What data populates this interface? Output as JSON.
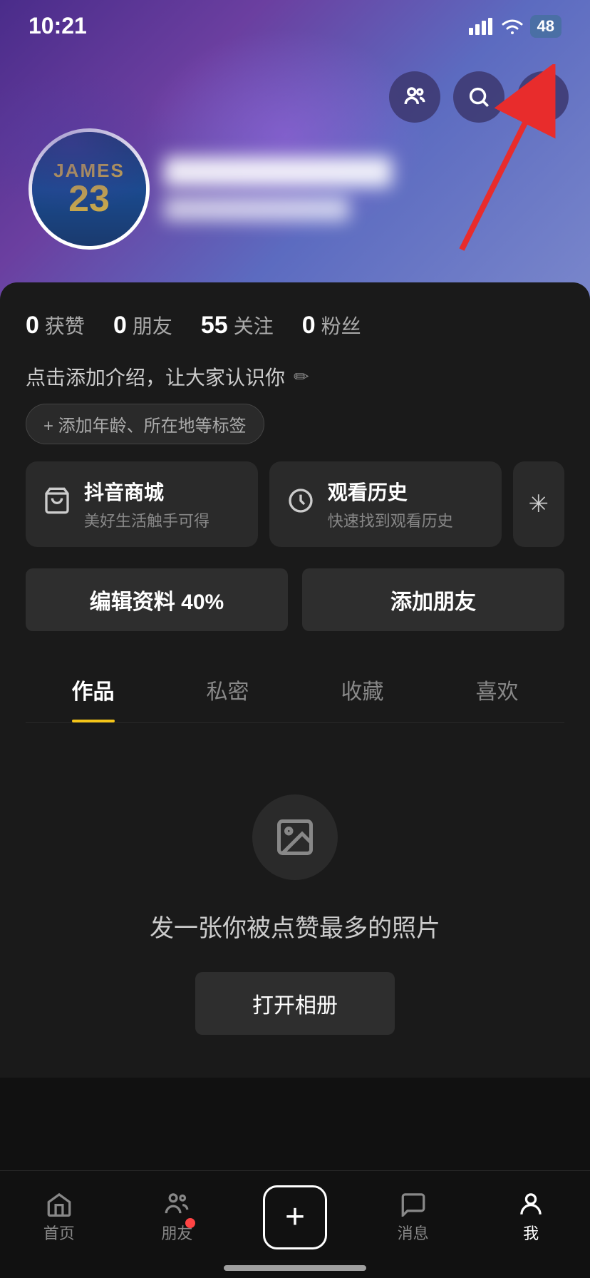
{
  "statusBar": {
    "time": "10:21",
    "battery": "48"
  },
  "headerButtons": {
    "friends": "friends-icon",
    "search": "search-icon",
    "menu": "menu-icon"
  },
  "profile": {
    "jerseyName": "JAMES",
    "jerseyNumber": "23",
    "stats": [
      {
        "num": "0",
        "label": "获赞"
      },
      {
        "num": "0",
        "label": "朋友"
      },
      {
        "num": "55",
        "label": "关注"
      },
      {
        "num": "0",
        "label": "粉丝"
      }
    ],
    "bioPlaceholder": "点击添加介绍，让大家认识你",
    "editIcon": "✏",
    "tagsAdd": "+ 添加年龄、所在地等标签",
    "services": [
      {
        "title": "抖音商城",
        "subtitle": "美好生活触手可得",
        "icon": "cart"
      },
      {
        "title": "观看历史",
        "subtitle": "快速找到观看历史",
        "icon": "clock"
      }
    ],
    "editProfileBtn": "编辑资料 40%",
    "addFriendBtn": "添加朋友",
    "tabs": [
      {
        "label": "作品",
        "active": true
      },
      {
        "label": "私密",
        "active": false
      },
      {
        "label": "收藏",
        "active": false
      },
      {
        "label": "喜欢",
        "active": false
      }
    ],
    "emptyState": {
      "text": "发一张你被点赞最多的照片",
      "btnLabel": "打开相册"
    }
  },
  "bottomNav": [
    {
      "label": "首页",
      "active": false,
      "hasDot": false
    },
    {
      "label": "朋友",
      "active": false,
      "hasDot": true
    },
    {
      "label": "+",
      "active": false,
      "hasDot": false,
      "isPlus": true
    },
    {
      "label": "消息",
      "active": false,
      "hasDot": false
    },
    {
      "label": "我",
      "active": true,
      "hasDot": false
    }
  ]
}
